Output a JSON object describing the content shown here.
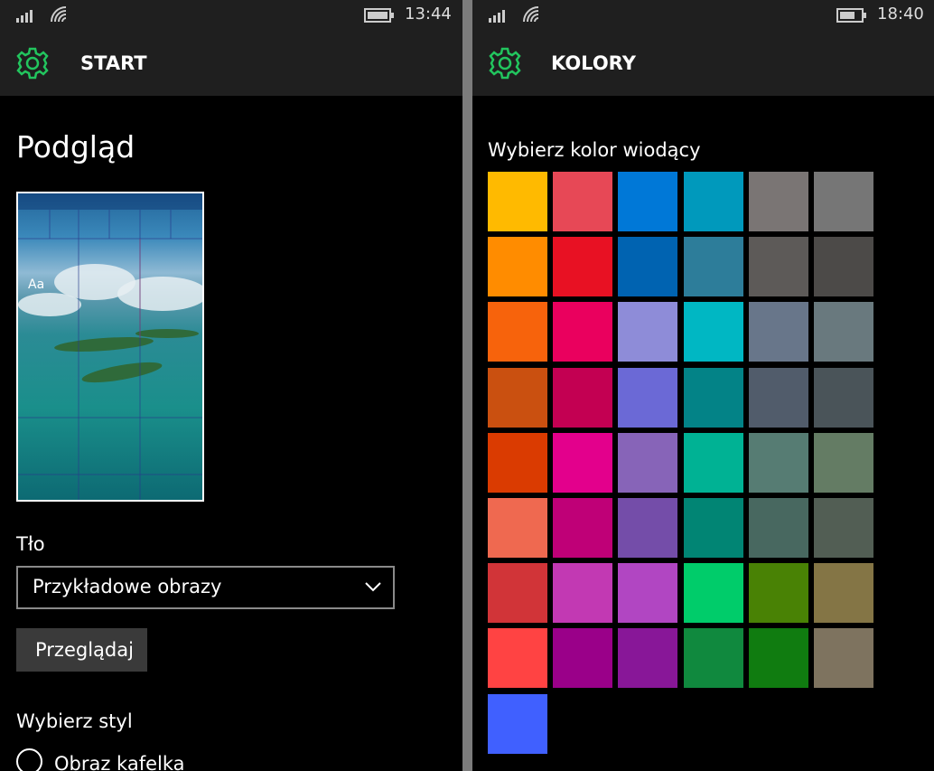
{
  "left": {
    "status": {
      "time": "13:44"
    },
    "app_title": "START",
    "preview_heading": "Podgląd",
    "preview_text": "Aa",
    "background_label": "Tło",
    "dropdown_value": "Przykładowe obrazy",
    "browse_button": "Przeglądaj",
    "style_label": "Wybierz styl",
    "radio_label": "Obraz kafelka"
  },
  "right": {
    "status": {
      "time": "18:40"
    },
    "app_title": "KOLORY",
    "accent_heading": "Wybierz kolor wiodący",
    "selected_color": "#00c060",
    "colors": [
      [
        "#ffba00",
        "#e74856",
        "#0078d7",
        "#0099bc",
        "#7a7574",
        "#767676"
      ],
      [
        "#ff8c00",
        "#e81123",
        "#0063b1",
        "#2d7d9a",
        "#5d5a58",
        "#4c4a48"
      ],
      [
        "#f7630c",
        "#ea005e",
        "#8e8cd8",
        "#00b7c3",
        "#68768a",
        "#69797e"
      ],
      [
        "#ca5010",
        "#c30052",
        "#6b69d6",
        "#038387",
        "#515c6b",
        "#4a5459"
      ],
      [
        "#da3b01",
        "#e3008c",
        "#8764b8",
        "#00b294",
        "#567c73",
        "#647c64"
      ],
      [
        "#ef6950",
        "#bf0077",
        "#744da9",
        "#018574",
        "#486860",
        "#525e54"
      ],
      [
        "#d13438",
        "#c239b3",
        "#b146c2",
        "#00cc6a",
        "#498205",
        "#847545"
      ],
      [
        "#ff4343",
        "#9a0089",
        "#881798",
        "#10893e",
        "#107c10",
        "#7e735f"
      ],
      [
        "#4060ff"
      ]
    ]
  },
  "theme": {
    "accent": "#22c55e",
    "bar_bg": "#1f1f1f",
    "bg": "#000000"
  }
}
